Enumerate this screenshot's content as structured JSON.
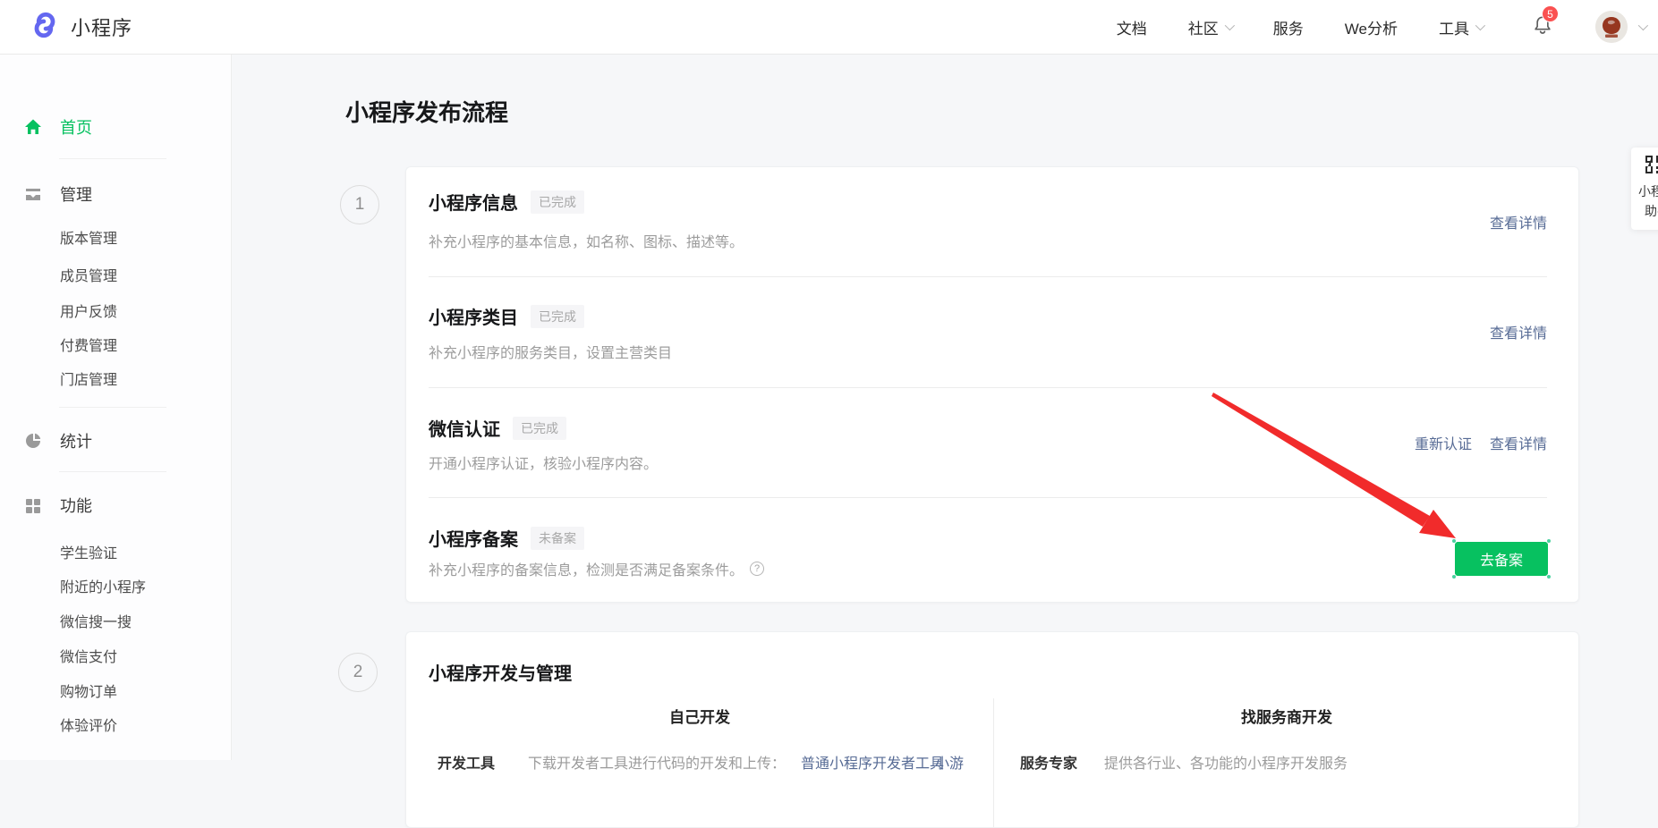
{
  "header": {
    "logo_text": "小程序",
    "nav_items": [
      {
        "label": "文档"
      },
      {
        "label": "社区"
      },
      {
        "label": "服务"
      },
      {
        "label": "We分析"
      },
      {
        "label": "工具"
      }
    ],
    "notification_count": "5"
  },
  "sidebar": {
    "home": "首页",
    "groups": [
      {
        "label": "管理",
        "items": [
          "版本管理",
          "成员管理",
          "用户反馈",
          "付费管理",
          "门店管理"
        ]
      },
      {
        "label": "统计",
        "items": []
      },
      {
        "label": "功能",
        "items": [
          "学生验证",
          "附近的小程序",
          "微信搜一搜",
          "微信支付",
          "购物订单",
          "体验评价"
        ]
      }
    ]
  },
  "main": {
    "page_title": "小程序发布流程",
    "step1": {
      "number": "1",
      "rows": [
        {
          "title": "小程序信息",
          "badge": "已完成",
          "desc": "补充小程序的基本信息，如名称、图标、描述等。",
          "actions": [
            "查看详情"
          ]
        },
        {
          "title": "小程序类目",
          "badge": "已完成",
          "desc": "补充小程序的服务类目，设置主营类目",
          "actions": [
            "查看详情"
          ]
        },
        {
          "title": "微信认证",
          "badge": "已完成",
          "desc": "开通小程序认证，核验小程序内容。",
          "actions": [
            "重新认证",
            "查看详情"
          ]
        },
        {
          "title": "小程序备案",
          "badge": "未备案",
          "desc": "补充小程序的备案信息，检测是否满足备案条件。",
          "help_icon": "?",
          "button": "去备案"
        }
      ]
    },
    "step2": {
      "number": "2",
      "title": "小程序开发与管理",
      "left": {
        "header": "自己开发",
        "row_label": "开发工具",
        "row_desc": "下载开发者工具进行代码的开发和上传：",
        "link1": "普通小程序开发者工具",
        "link2": "小游"
      },
      "right": {
        "header": "找服务商开发",
        "row_label": "服务专家",
        "row_desc": "提供各行业、各功能的小程序开发服务"
      }
    }
  },
  "widget": {
    "line1": "小程序",
    "line2": "助手"
  },
  "colors": {
    "brand_green": "#07c160",
    "logo_purple": "#6467f0",
    "link_blue": "#576b95",
    "badge_red": "#fa5151",
    "arrow_red": "#f12b2b",
    "badge_gray_bg": "#f5f5f7",
    "badge_gray_text": "#a8a8a8"
  }
}
